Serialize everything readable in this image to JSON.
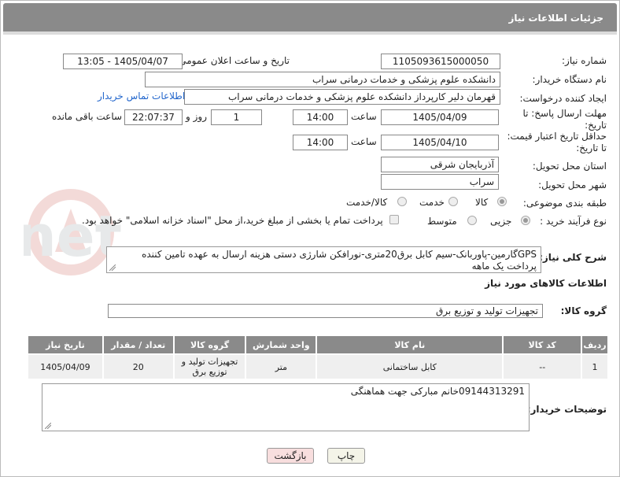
{
  "header": {
    "title": "جزئیات اطلاعات نیاز"
  },
  "form": {
    "need_number": {
      "label": "شماره نیاز:",
      "value": "1105093615000050"
    },
    "announce": {
      "label": "تاریخ و ساعت اعلان عمومی:",
      "value": "1405/04/07 - 13:05"
    },
    "buyer_org": {
      "label": "نام دستگاه خریدار:",
      "value": "دانشکده علوم پزشکی و خدمات درمانی سراب"
    },
    "requester": {
      "label": "ایجاد کننده درخواست:",
      "value": "قهرمان دلیر کارپرداز دانشکده علوم پزشکی و خدمات درمانی سراب",
      "contact_link": "اطلاعات تماس خریدار"
    },
    "deadline": {
      "label_line1": "مهلت ارسال پاسخ: تا",
      "label_line2": "تاریخ:",
      "date": "1405/04/09",
      "time_label": "ساعت",
      "time": "14:00",
      "days": "1",
      "days_label": "روز و",
      "remaining": "22:07:37",
      "remaining_label": "ساعت باقی مانده"
    },
    "validity": {
      "label_line1": "حداقل تاریخ اعتبار قیمت:",
      "label_line2": "تا تاریخ:",
      "date": "1405/04/10",
      "time_label": "ساعت",
      "time": "14:00"
    },
    "province": {
      "label": "استان محل تحویل:",
      "value": "آذربایجان شرقی"
    },
    "city": {
      "label": "شهر محل تحویل:",
      "value": "سراب"
    },
    "category": {
      "label": "طبقه بندی موضوعی:",
      "options": [
        "کالا",
        "خدمت",
        "کالا/خدمت"
      ],
      "selected": "کالا"
    },
    "process": {
      "label": "نوع فرآیند خرید :",
      "options": [
        "جزیی",
        "متوسط"
      ],
      "selected": "جزیی",
      "payment_note": "پرداخت تمام یا بخشی از مبلغ خرید،از محل \"اسناد خزانه اسلامی\" خواهد بود."
    }
  },
  "general_desc": {
    "label": "شرح کلی نیاز:",
    "value": "GPSگارمین-پاوربانک-سیم کابل برق20متری-نورافکن شارژی دستی هزینه ارسال به عهده تامین کننده پرداخت یک ماهه"
  },
  "goods_section": {
    "title": "اطلاعات کالاهای مورد نیاز",
    "group_label": "گروه کالا:",
    "group_value": "تجهیزات تولید و توزیع برق"
  },
  "table": {
    "headers": [
      "ردیف",
      "کد کالا",
      "نام کالا",
      "واحد شمارش",
      "گروه کالا",
      "تعداد / مقدار",
      "تاریخ نیاز"
    ],
    "rows": [
      [
        "1",
        "--",
        "کابل ساختمانی",
        "متر",
        "تجهیزات تولید و توزیع برق",
        "20",
        "1405/04/09"
      ]
    ]
  },
  "buyer_notes": {
    "label": "توضیحات خریدار:",
    "value": "09144313291خانم مبارکی جهت هماهنگی"
  },
  "buttons": {
    "print": "چاپ",
    "back": "بازگشت"
  },
  "colors": {
    "header_bg": "#8a8a8a",
    "link": "#2266cc",
    "print_btn": "#f4f4e8",
    "back_btn": "#f8dede"
  }
}
